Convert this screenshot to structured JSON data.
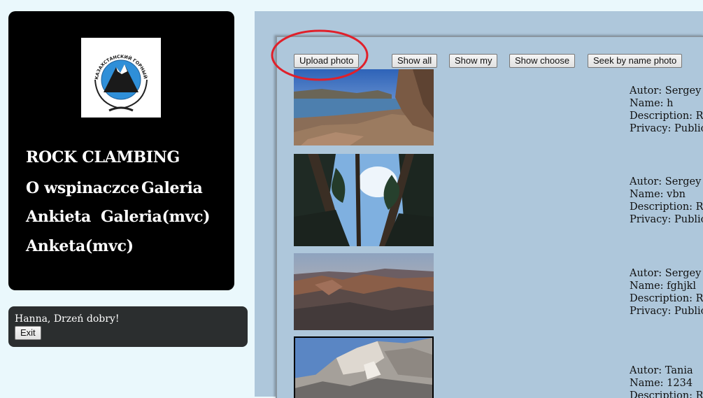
{
  "nav": {
    "site_title": "ROCK CLAMBING",
    "links": [
      "O wspinaczce",
      "Galeria",
      "Ankieta",
      "Galeria(mvc)",
      "Anketa(mvc)"
    ]
  },
  "logo": {
    "text": "КАЗАХСТАНСКИЙ ГОРНЫЙ КЛУБ"
  },
  "user": {
    "greeting": "Hanna, Drzeń dobry!",
    "exit_label": "Exit"
  },
  "toolbar": {
    "upload": "Upload photo",
    "show_all": "Show all",
    "show_my": "Show my",
    "show_choose": "Show choose",
    "seek": "Seek by name photo"
  },
  "photos": [
    {
      "author": "Autor: Sergey",
      "name": "Name: h",
      "description": "Description: RO",
      "privacy": "Privacy: Public"
    },
    {
      "author": "Autor: Sergey",
      "name": "Name: vbn",
      "description": "Description: RO",
      "privacy": "Privacy: Public"
    },
    {
      "author": "Autor: Sergey",
      "name": "Name: fghjkl",
      "description": "Description: RO",
      "privacy": "Privacy: Public"
    },
    {
      "author": "Autor: Tania",
      "name": "Name: 1234",
      "description": "Description: RO"
    }
  ],
  "colors": {
    "page_bg": "#eaf8fc",
    "nav_bg": "#000000",
    "greeting_bg": "#2b2e2f",
    "main_bg": "#aec7db",
    "highlight_ellipse": "#e0202a"
  }
}
